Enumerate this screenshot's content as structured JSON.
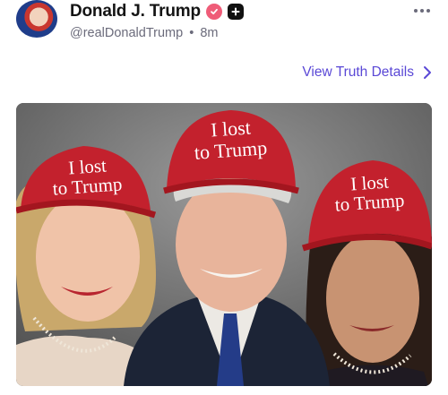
{
  "post": {
    "display_name": "Donald J. Trump",
    "handle": "@realDonaldTrump",
    "separator": "•",
    "time": "8m",
    "details_link": "View Truth Details"
  },
  "image": {
    "hat_line1": "I lost",
    "hat_line2": "to Trump"
  },
  "icons": {
    "verified": "verified-check-icon",
    "plus": "plus-badge-icon",
    "more": "more-dots-icon",
    "chevron": "chevron-right-icon"
  },
  "colors": {
    "link": "#5a48d6",
    "verified": "#ef5c78",
    "hat": "#c3212d"
  }
}
